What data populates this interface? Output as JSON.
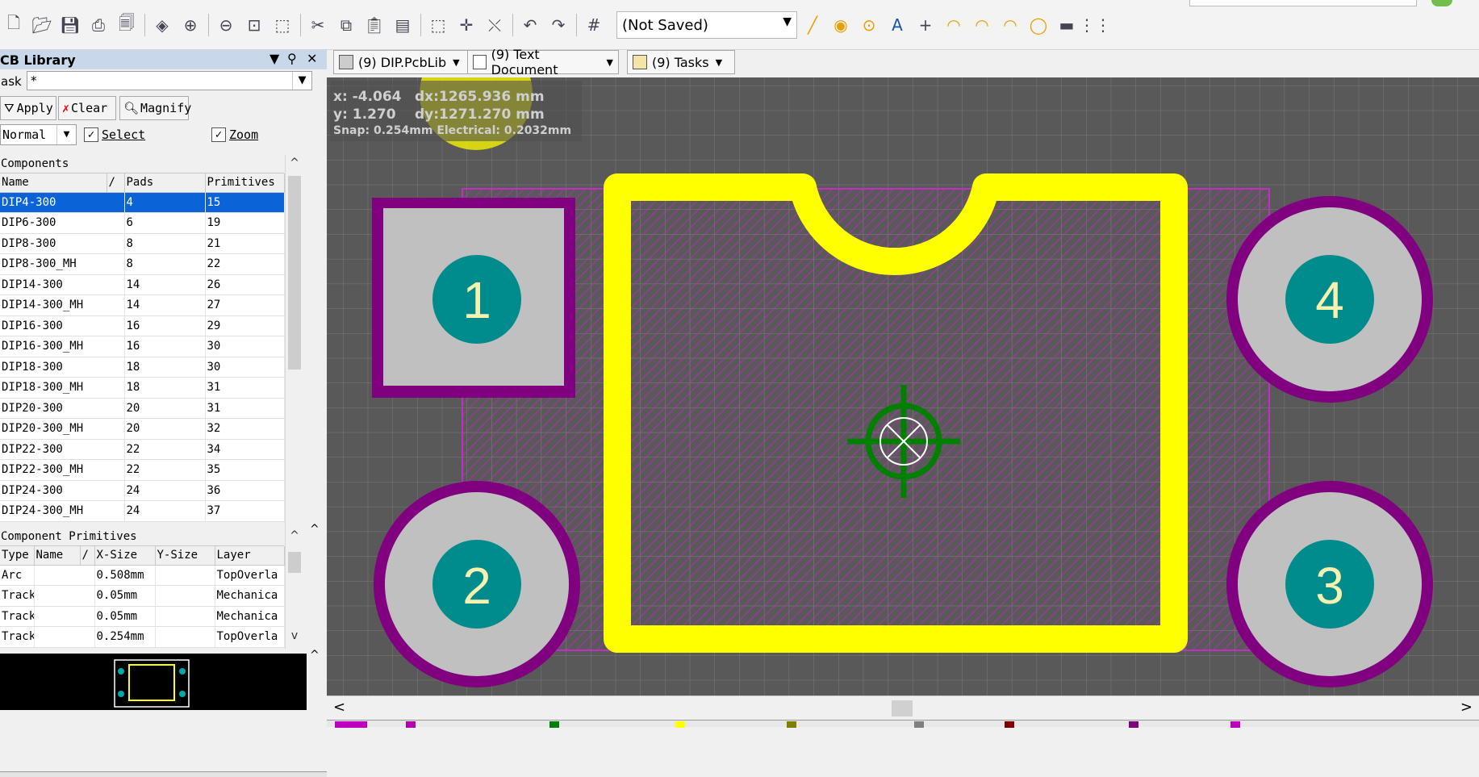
{
  "toolbar": {
    "state_combo": "(Not Saved)",
    "icons": [
      "new-icon",
      "open-icon",
      "save-icon",
      "print-icon",
      "print-preview-icon",
      "3d-layer-icon",
      "zoom-in-icon",
      "zoom-out-icon",
      "zoom-fit-icon",
      "zoom-area-icon",
      "cut-icon",
      "copy-icon",
      "paste-icon",
      "rubber-stamp-icon",
      "select-area-icon",
      "move-icon",
      "deselect-icon",
      "undo-icon",
      "redo-icon",
      "grid-icon",
      "place-line-icon",
      "place-pad-icon",
      "place-via-icon",
      "place-string-icon",
      "place-coordinate-icon",
      "arc-center-icon",
      "arc-edge-icon",
      "arc-any-icon",
      "full-circle-icon",
      "place-fill-icon",
      "array-paste-icon"
    ]
  },
  "panel": {
    "title": "CB Library",
    "mask_label": "ask",
    "mask_value": "*",
    "apply": "Apply",
    "clear": "Clear",
    "magnify": "Magnify",
    "mode": "Normal",
    "select_label": "Select",
    "zoom_label": "Zoom",
    "components": {
      "title": "Components",
      "headers": [
        "Name",
        "/",
        "Pads",
        "Primitives"
      ],
      "rows": [
        [
          "DIP4-300",
          "4",
          "15"
        ],
        [
          "DIP6-300",
          "6",
          "19"
        ],
        [
          "DIP8-300",
          "8",
          "21"
        ],
        [
          "DIP8-300_MH",
          "8",
          "22"
        ],
        [
          "DIP14-300",
          "14",
          "26"
        ],
        [
          "DIP14-300_MH",
          "14",
          "27"
        ],
        [
          "DIP16-300",
          "16",
          "29"
        ],
        [
          "DIP16-300_MH",
          "16",
          "30"
        ],
        [
          "DIP18-300",
          "18",
          "30"
        ],
        [
          "DIP18-300_MH",
          "18",
          "31"
        ],
        [
          "DIP20-300",
          "20",
          "31"
        ],
        [
          "DIP20-300_MH",
          "20",
          "32"
        ],
        [
          "DIP22-300",
          "22",
          "34"
        ],
        [
          "DIP22-300_MH",
          "22",
          "35"
        ],
        [
          "DIP24-300",
          "24",
          "36"
        ],
        [
          "DIP24-300_MH",
          "24",
          "37"
        ]
      ]
    },
    "primitives": {
      "title": "Component Primitives",
      "headers": [
        "Type",
        "Name",
        "/",
        "X-Size",
        "Y-Size",
        "Layer"
      ],
      "rows": [
        [
          "Arc",
          "",
          "0.508mm",
          "",
          "TopOverla"
        ],
        [
          "Track",
          "",
          "0.05mm",
          "",
          "Mechanica"
        ],
        [
          "Track",
          "",
          "0.05mm",
          "",
          "Mechanica"
        ],
        [
          "Track",
          "",
          "0.254mm",
          "",
          "TopOverla"
        ]
      ]
    }
  },
  "doc_tabs": [
    {
      "label": "(9) DIP.PcbLib"
    },
    {
      "label": "(9) Text Document"
    },
    {
      "label": "(9) Tasks"
    }
  ],
  "hud": {
    "x": "x: -4.064",
    "dx": "dx:1265.936  mm",
    "y": "y:  1.270",
    "dy": "dy:1271.270  mm",
    "snap": "Snap: 0.254mm Electrical: 0.2032mm"
  },
  "pads": [
    "1",
    "2",
    "3",
    "4"
  ],
  "colors": {
    "board": "#595959",
    "keepout": "#9b2f9b",
    "overlay": "#ffff00",
    "pad_gray": "#c0c0c0",
    "pad_teal": "#008c8c",
    "pad_ring": "#800080",
    "origin": "#008000",
    "selection": "#0a64d8"
  }
}
